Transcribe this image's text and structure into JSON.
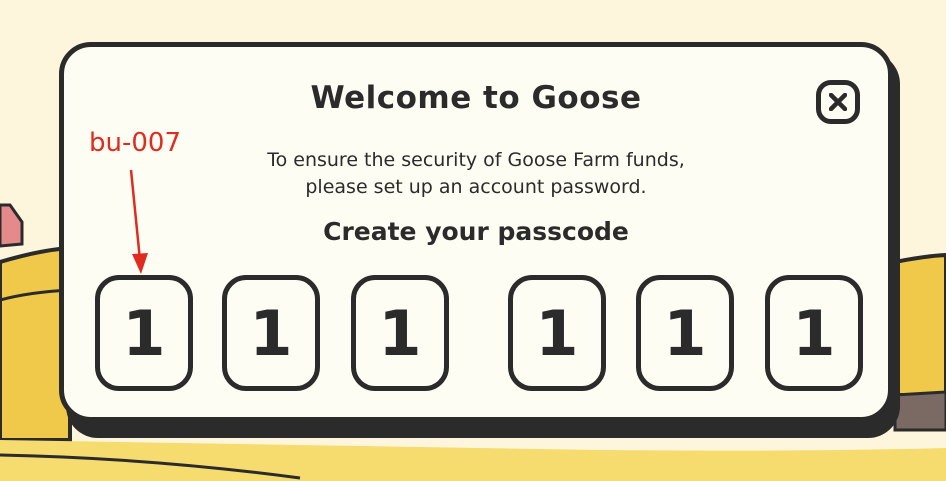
{
  "modal": {
    "title": "Welcome to Goose",
    "description_line1": "To ensure the security of Goose Farm funds,",
    "description_line2": "please set up an account password.",
    "subtitle": "Create your passcode",
    "close_icon": "close-x-icon"
  },
  "passcode": {
    "digits": [
      "1",
      "1",
      "1",
      "1",
      "1",
      "1"
    ]
  },
  "annotation": {
    "label": "bu-007",
    "color": "#e02b20"
  },
  "colors": {
    "background": "#fdf6dc",
    "modal_fill": "#fdfdf3",
    "outline": "#2b2b2b",
    "field_yellow": "#f4d35e",
    "field_dark": "#e3b832",
    "roof_red": "#e58a8a",
    "annotation_red": "#e02b20"
  }
}
